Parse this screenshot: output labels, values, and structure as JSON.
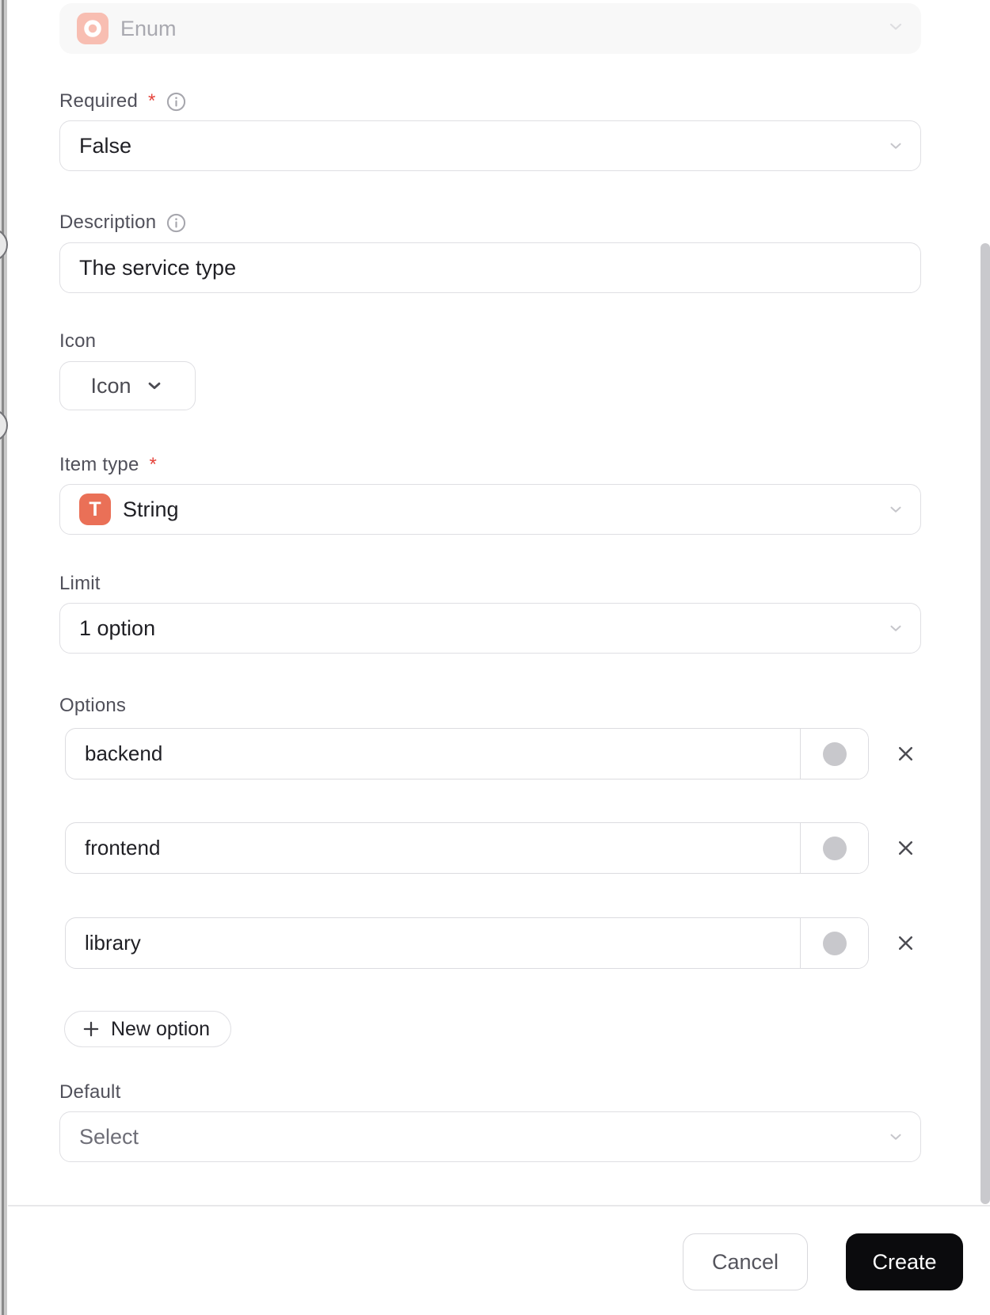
{
  "dialog": {
    "type_field": {
      "value": "Enum"
    },
    "required": {
      "label": "Required",
      "required_mark": "*",
      "value": "False"
    },
    "description": {
      "label": "Description",
      "value": "The service type"
    },
    "icon": {
      "label": "Icon",
      "button_label": "Icon"
    },
    "item_type": {
      "label": "Item type",
      "required_mark": "*",
      "icon_letter": "T",
      "value": "String"
    },
    "limit": {
      "label": "Limit",
      "value": "1 option"
    },
    "options": {
      "label": "Options",
      "items": [
        "backend",
        "frontend",
        "library"
      ],
      "new_option_label": "New option"
    },
    "default": {
      "label": "Default",
      "placeholder": "Select"
    },
    "footer": {
      "cancel_label": "Cancel",
      "create_label": "Create"
    }
  },
  "colors": {
    "enum_icon_bg": "#f8beb2",
    "item_type_icon_bg": "#ea7057",
    "required_mark": "#e5443c",
    "swatch_gray": "#c8c8cc",
    "create_button_bg": "#0b0b0d",
    "border": "#dfdfe3"
  }
}
